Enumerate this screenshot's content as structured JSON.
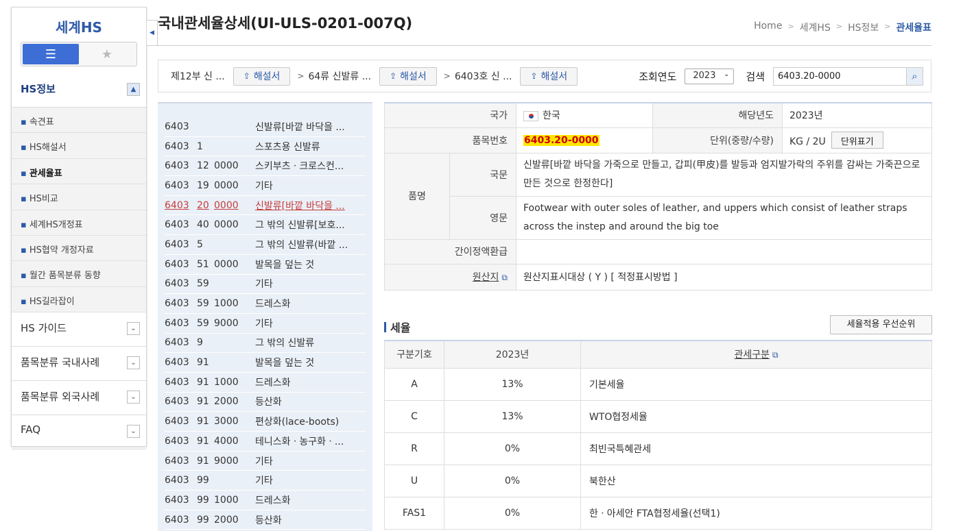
{
  "sidebar": {
    "title": "세계HS",
    "section_active": "HS정보",
    "sub_items": [
      "속견표",
      "HS해설서",
      "관세율표",
      "HS비교",
      "세계HS개정표",
      "HS협약 개정자료",
      "월간 품목분류 동향",
      "HS길라잡이"
    ],
    "current_index": 2,
    "sections": [
      "HS 가이드",
      "품목분류 국내사례",
      "품목분류 외국사례",
      "FAQ"
    ]
  },
  "page": {
    "title": "국내관세율상세(UI-ULS-0201-007Q)",
    "breadcrumb": [
      "Home",
      "세계HS",
      "HS정보",
      "관세율표"
    ]
  },
  "filter": {
    "levels": [
      "제12부 신 ...",
      "64류 신발류 ...",
      "6403호 신 ..."
    ],
    "explain_label": "해설서",
    "year_label": "조회연도",
    "year_value": "2023",
    "search_label": "검색",
    "search_value": "6403.20-0000"
  },
  "code_list": [
    {
      "a": "6403",
      "b": "",
      "c": "",
      "d": "신발류[바깥 바닥을 ..."
    },
    {
      "a": "6403",
      "b": "1",
      "c": "",
      "d": "스포츠용 신발류"
    },
    {
      "a": "6403",
      "b": "12",
      "c": "0000",
      "d": "스키부츠ㆍ크로스컨..."
    },
    {
      "a": "6403",
      "b": "19",
      "c": "0000",
      "d": "기타"
    },
    {
      "a": "6403",
      "b": "20",
      "c": "0000",
      "d": "신발류[바깥 바닥을 ..."
    },
    {
      "a": "6403",
      "b": "40",
      "c": "0000",
      "d": "그 밖의 신발류[보호..."
    },
    {
      "a": "6403",
      "b": "5",
      "c": "",
      "d": "그 밖의 신발류(바깥 ..."
    },
    {
      "a": "6403",
      "b": "51",
      "c": "0000",
      "d": "발목을 덮는 것"
    },
    {
      "a": "6403",
      "b": "59",
      "c": "",
      "d": "기타"
    },
    {
      "a": "6403",
      "b": "59",
      "c": "1000",
      "d": "드레스화"
    },
    {
      "a": "6403",
      "b": "59",
      "c": "9000",
      "d": "기타"
    },
    {
      "a": "6403",
      "b": "9",
      "c": "",
      "d": "그 밖의 신발류"
    },
    {
      "a": "6403",
      "b": "91",
      "c": "",
      "d": "발목을 덮는 것"
    },
    {
      "a": "6403",
      "b": "91",
      "c": "1000",
      "d": "드레스화"
    },
    {
      "a": "6403",
      "b": "91",
      "c": "2000",
      "d": "등산화"
    },
    {
      "a": "6403",
      "b": "91",
      "c": "3000",
      "d": "편상화(lace-boots)"
    },
    {
      "a": "6403",
      "b": "91",
      "c": "4000",
      "d": "테니스화ㆍ농구화ㆍ..."
    },
    {
      "a": "6403",
      "b": "91",
      "c": "9000",
      "d": "기타"
    },
    {
      "a": "6403",
      "b": "99",
      "c": "",
      "d": "기타"
    },
    {
      "a": "6403",
      "b": "99",
      "c": "1000",
      "d": "드레스화"
    },
    {
      "a": "6403",
      "b": "99",
      "c": "2000",
      "d": "등산화"
    }
  ],
  "code_list_selected": 4,
  "detail": {
    "country_label": "국가",
    "country_value": "한국",
    "year_label": "해당년도",
    "year_value": "2023년",
    "code_label": "품목번호",
    "code_value": "6403.20-0000",
    "unit_label": "단위(중량/수량)",
    "unit_value": "KG / 2U",
    "unit_button": "단위표기",
    "name_label": "품명",
    "ko_label": "국문",
    "ko_value": "신발류[바깥 바닥을 가죽으로 만들고, 갑피(甲皮)를 발등과 엄지발가락의 주위를 감싸는 가죽끈으로 만든 것으로 한정한다]",
    "en_label": "영문",
    "en_value": "Footwear with outer soles of leather, and uppers which consist of leather straps across the instep and around the big toe",
    "refund_label": "간이정액환급",
    "refund_value": "",
    "origin_label": "원산지",
    "origin_value": "원산지표시대상 ( Y ) [ 적정표시방법 ]"
  },
  "tariff": {
    "title": "세율",
    "priority_button": "세율적용 우선순위",
    "headers": [
      "구분기호",
      "2023년",
      "관세구분"
    ],
    "rows": [
      {
        "code": "A",
        "rate": "13%",
        "type": "기본세율"
      },
      {
        "code": "C",
        "rate": "13%",
        "type": "WTO협정세율"
      },
      {
        "code": "R",
        "rate": "0%",
        "type": "최빈국특혜관세"
      },
      {
        "code": "U",
        "rate": "0%",
        "type": "북한산"
      },
      {
        "code": "FAS1",
        "rate": "0%",
        "type": "한ㆍ아세안 FTA협정세율(선택1)"
      }
    ]
  }
}
